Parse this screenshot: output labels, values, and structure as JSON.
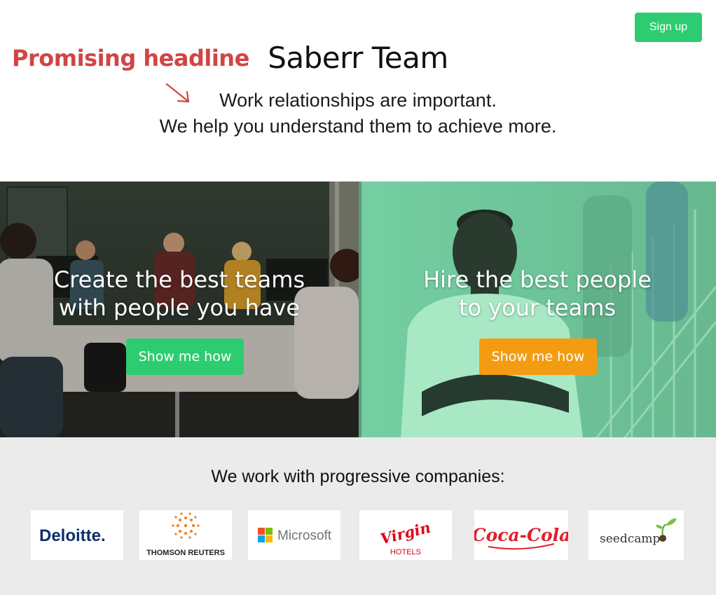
{
  "header": {
    "signup_label": "Sign up",
    "annotation": "Promising headline",
    "title": "Saberr Team",
    "tagline_line1": "Work relationships are important.",
    "tagline_line2": "We help you understand them to achieve more."
  },
  "hero": {
    "left": {
      "heading_line1": "Create the best teams",
      "heading_line2": "with people you have",
      "cta_label": "Show me how"
    },
    "right": {
      "heading_line1": "Hire the best people",
      "heading_line2": "to your teams",
      "cta_label": "Show me how"
    }
  },
  "partners": {
    "title": "We work with progressive companies:",
    "logos": [
      {
        "name": "Deloitte",
        "text": "Deloitte."
      },
      {
        "name": "Thomson Reuters",
        "text": "THOMSON REUTERS"
      },
      {
        "name": "Microsoft",
        "text": "Microsoft"
      },
      {
        "name": "Virgin Hotels",
        "text": "Virgin",
        "sub": "HOTELS"
      },
      {
        "name": "Coca-Cola",
        "text": "Coca-Cola"
      },
      {
        "name": "seedcamp",
        "text": "seedcamp"
      }
    ]
  },
  "colors": {
    "accent_green": "#2ecc71",
    "accent_orange": "#f39c12",
    "annotation_red": "#d14545",
    "partners_bg": "#ebebeb"
  },
  "icons": [
    "annotation-arrow-icon",
    "thomson-reuters-sunburst-icon",
    "microsoft-squares-icon",
    "seedcamp-sprout-icon"
  ]
}
